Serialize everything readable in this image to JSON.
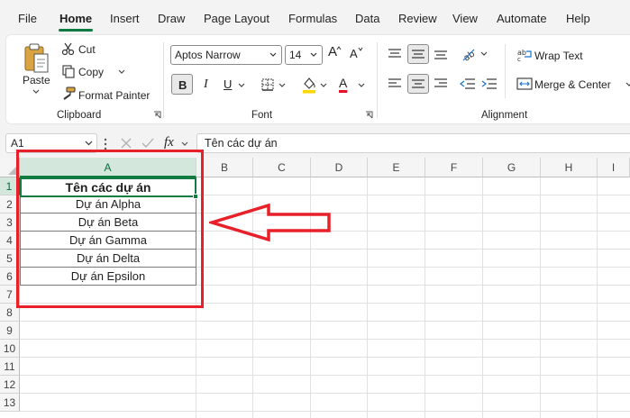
{
  "menu": {
    "file": "File",
    "home": "Home",
    "insert": "Insert",
    "draw": "Draw",
    "page_layout": "Page Layout",
    "formulas": "Formulas",
    "data": "Data",
    "review": "Review",
    "view": "View",
    "automate": "Automate",
    "help": "Help"
  },
  "clipboard": {
    "paste": "Paste",
    "cut": "Cut",
    "copy": "Copy",
    "format_painter": "Format Painter",
    "group_label": "Clipboard"
  },
  "font": {
    "family": "Aptos Narrow",
    "size": "14",
    "bold": "B",
    "italic": "I",
    "underline": "U",
    "font_color_letter": "A",
    "grow_letter": "A",
    "shrink_letter": "A",
    "group_label": "Font",
    "fill_color": "#ffd600",
    "text_color": "#e81123"
  },
  "alignment": {
    "wrap_text": "Wrap Text",
    "merge_center": "Merge & Center",
    "group_label": "Alignment"
  },
  "formula_bar": {
    "name_box": "A1",
    "fx": "fx",
    "content": "Tên các dự án"
  },
  "columns": [
    "A",
    "B",
    "C",
    "D",
    "E",
    "F",
    "G",
    "H",
    "I"
  ],
  "rows": [
    "1",
    "2",
    "3",
    "4",
    "5",
    "6",
    "7",
    "8",
    "9",
    "10",
    "11",
    "12",
    "13"
  ],
  "cells": {
    "a1": "Tên các dự án",
    "a2": "Dự án Alpha",
    "a3": "Dự án Beta",
    "a4": "Dự án Gamma",
    "a5": "Dự án Delta",
    "a6": "Dự án Epsilon"
  },
  "colors": {
    "accent": "#107c41",
    "annotation": "#e8202a"
  }
}
